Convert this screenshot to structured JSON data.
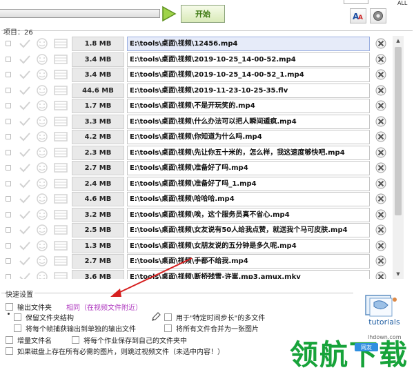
{
  "toolbar": {
    "start_label": "开始",
    "top_right_label": "ALL"
  },
  "items_header": "项目：26",
  "files": [
    {
      "size": "1.8 MB",
      "path": "E:\\tools\\桌面\\视频\\12456.mp4",
      "selected": true
    },
    {
      "size": "3.4 MB",
      "path": "E:\\tools\\桌面\\视频\\2019-10-25_14-00-52.mp4"
    },
    {
      "size": "3.4 MB",
      "path": "E:\\tools\\桌面\\视频\\2019-10-25_14-00-52_1.mp4"
    },
    {
      "size": "44.6 MB",
      "path": "E:\\tools\\桌面\\视频\\2019-11-23-10-25-35.flv"
    },
    {
      "size": "1.7 MB",
      "path": "E:\\tools\\桌面\\视频\\不是开玩笑的.mp4"
    },
    {
      "size": "3.3 MB",
      "path": "E:\\tools\\桌面\\视频\\什么办法可以把人瞬间遁疯.mp4"
    },
    {
      "size": "4.2 MB",
      "path": "E:\\tools\\桌面\\视频\\你知道为什么吗.mp4"
    },
    {
      "size": "2.3 MB",
      "path": "E:\\tools\\桌面\\视频\\先让你五十米的，怎么样，我这速度够快吧.mp4"
    },
    {
      "size": "2.7 MB",
      "path": "E:\\tools\\桌面\\视频\\准备好了吗.mp4"
    },
    {
      "size": "2.4 MB",
      "path": "E:\\tools\\桌面\\视频\\准备好了吗_1.mp4"
    },
    {
      "size": "4.6 MB",
      "path": "E:\\tools\\桌面\\视频\\哈哈哈.mp4"
    },
    {
      "size": "3.2 MB",
      "path": "E:\\tools\\桌面\\视频\\唉，这个服务员真不省心.mp4"
    },
    {
      "size": "2.5 MB",
      "path": "E:\\tools\\桌面\\视频\\女友说有50人给我点赞，就送我个马可皮肤.mp4"
    },
    {
      "size": "1.3 MB",
      "path": "E:\\tools\\桌面\\视频\\女朋友说的五分钟是多久呢.mp4"
    },
    {
      "size": "2.7 MB",
      "path": "E:\\tools\\桌面\\视频\\手都不给我.mp4"
    },
    {
      "size": "3.6 MB",
      "path": "E:\\tools\\桌面\\视频\\断桥残雪-许嵩.mp3.amux.mkv"
    }
  ],
  "quick": {
    "title": "快速设置",
    "output_folder": "输出文件夹",
    "output_folder_value": "相同（在视频文件附近）",
    "keep_structure": "保留文件夹结构",
    "time_step": "用于\"特定时间步长\"的多文件",
    "each_frame": "将每个帧捕获输出到单独的输出文件",
    "merge_all": "将所有文件合并为一张图片",
    "incremental": "增量文件名",
    "each_job": "将每个作业保存到自己的文件夹中",
    "skip": "如果磁盘上存在所有必需的图片，则跳过视频文件（未选中内容！）"
  },
  "branding": {
    "tutorials": "tutorials",
    "site": "lhdown.com",
    "watermark": "领航下载",
    "badge": "网友"
  },
  "colors": {
    "accent_green": "#3e7a12",
    "link_purple": "#b03cc0",
    "arrow_red": "#d62020",
    "watermark_green": "#17a33a"
  }
}
